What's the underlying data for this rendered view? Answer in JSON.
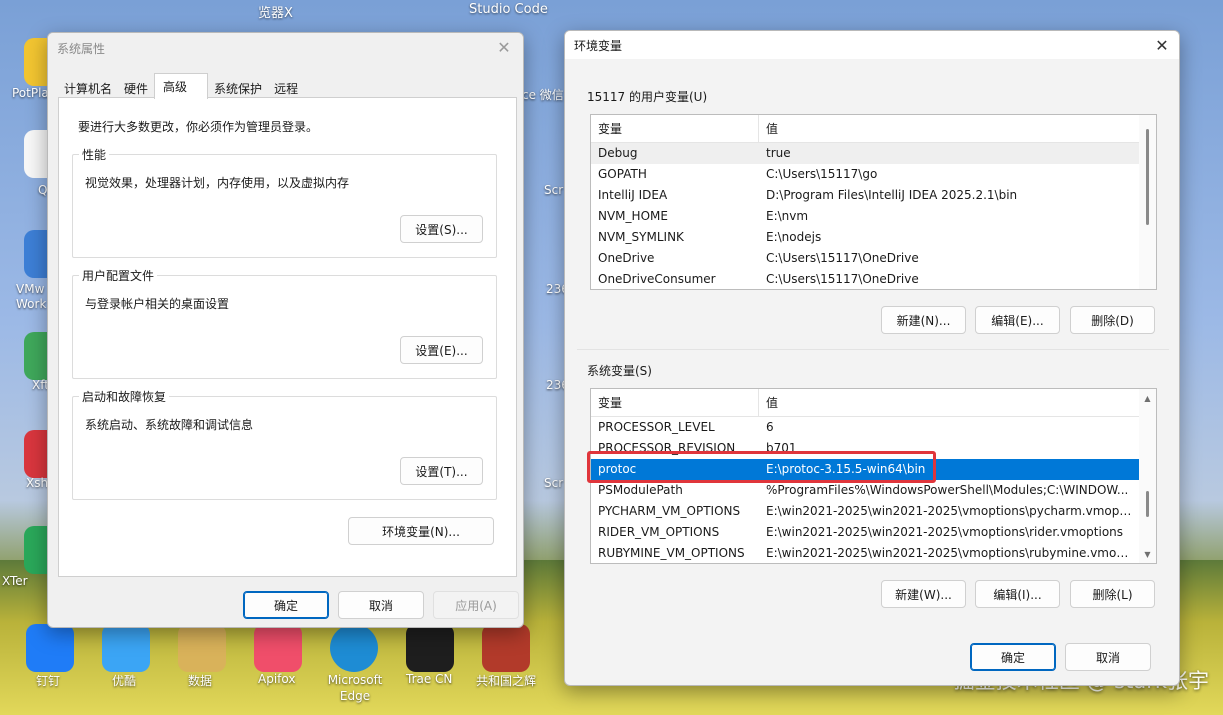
{
  "desktop": {
    "top_labels": [
      "览器X",
      "Studio Code"
    ],
    "left_icons": [
      "PotPla",
      "Q",
      "VMw Work",
      "Xft",
      "Xsh",
      "XTer"
    ],
    "middle_icons": [
      "ce 微信",
      "Scr",
      "236",
      "236",
      "Scr"
    ],
    "taskbar_icons": [
      {
        "label": "钉钉",
        "color": "#1f7cf7"
      },
      {
        "label": "优酷",
        "color": "#3ba5f5"
      },
      {
        "label": "数据",
        "color": "#d9b25a"
      },
      {
        "label": "Apifox",
        "color": "#f04e6a"
      },
      {
        "label": "Microsoft Edge",
        "color": "#1e8cd4"
      },
      {
        "label": "Trae CN",
        "color": "#1e1e1e"
      },
      {
        "label": "共和国之辉",
        "color": "#b23a2a"
      }
    ],
    "watermark": "掘金技术社区 @ stark张宇"
  },
  "system_properties": {
    "title": "系统属性",
    "tabs": [
      "计算机名",
      "硬件",
      "高级",
      "系统保护",
      "远程"
    ],
    "admin_note": "要进行大多数更改，你必须作为管理员登录。",
    "performance": {
      "title": "性能",
      "desc": "视觉效果，处理器计划，内存使用，以及虚拟内存",
      "button": "设置(S)..."
    },
    "user_profiles": {
      "title": "用户配置文件",
      "desc": "与登录帐户相关的桌面设置",
      "button": "设置(E)..."
    },
    "startup_recovery": {
      "title": "启动和故障恢复",
      "desc": "系统启动、系统故障和调试信息",
      "button": "设置(T)..."
    },
    "env_button": "环境变量(N)...",
    "ok": "确定",
    "cancel": "取消",
    "apply": "应用(A)"
  },
  "env_vars": {
    "title": "环境变量",
    "user_section": "15117 的用户变量(U)",
    "system_section": "系统变量(S)",
    "col_name": "变量",
    "col_value": "值",
    "user_vars": [
      {
        "name": "Debug",
        "value": "true"
      },
      {
        "name": "GOPATH",
        "value": "C:\\Users\\15117\\go"
      },
      {
        "name": "IntelliJ IDEA",
        "value": "D:\\Program Files\\IntelliJ IDEA 2025.2.1\\bin"
      },
      {
        "name": "NVM_HOME",
        "value": "E:\\nvm"
      },
      {
        "name": "NVM_SYMLINK",
        "value": "E:\\nodejs"
      },
      {
        "name": "OneDrive",
        "value": "C:\\Users\\15117\\OneDrive"
      },
      {
        "name": "OneDriveConsumer",
        "value": "C:\\Users\\15117\\OneDrive"
      }
    ],
    "system_vars": [
      {
        "name": "PROCESSOR_LEVEL",
        "value": "6"
      },
      {
        "name": "PROCESSOR_REVISION",
        "value": "b701"
      },
      {
        "name": "protoc",
        "value": "E:\\protoc-3.15.5-win64\\bin"
      },
      {
        "name": "PSModulePath",
        "value": "%ProgramFiles%\\WindowsPowerShell\\Modules;C:\\WINDOW..."
      },
      {
        "name": "PYCHARM_VM_OPTIONS",
        "value": "E:\\win2021-2025\\win2021-2025\\vmoptions\\pycharm.vmoptions"
      },
      {
        "name": "RIDER_VM_OPTIONS",
        "value": "E:\\win2021-2025\\win2021-2025\\vmoptions\\rider.vmoptions"
      },
      {
        "name": "RUBYMINE_VM_OPTIONS",
        "value": "E:\\win2021-2025\\win2021-2025\\vmoptions\\rubymine.vmoptio..."
      }
    ],
    "user_buttons": {
      "new": "新建(N)...",
      "edit": "编辑(E)...",
      "delete": "删除(D)"
    },
    "system_buttons": {
      "new": "新建(W)...",
      "edit": "编辑(I)...",
      "delete": "删除(L)"
    },
    "ok": "确定",
    "cancel": "取消"
  }
}
